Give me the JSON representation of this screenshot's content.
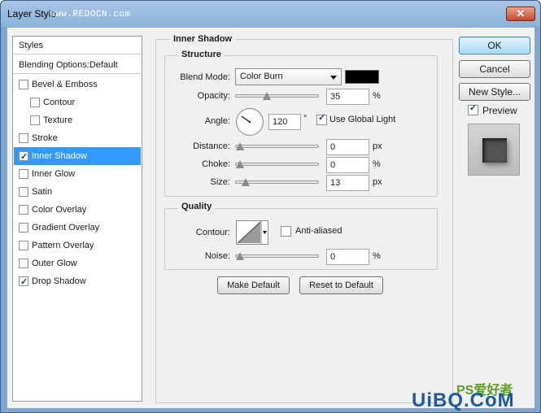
{
  "window": {
    "title": "Layer Style",
    "title_watermark": "www.REDOCN.com",
    "close_label": "✕"
  },
  "styles_list": {
    "header": "Styles",
    "blending_options": "Blending Options:Default",
    "items": [
      {
        "label": "Bevel & Emboss",
        "checked": false,
        "indent": false
      },
      {
        "label": "Contour",
        "checked": false,
        "indent": true
      },
      {
        "label": "Texture",
        "checked": false,
        "indent": true
      },
      {
        "label": "Stroke",
        "checked": false,
        "indent": false
      },
      {
        "label": "Inner Shadow",
        "checked": true,
        "indent": false,
        "selected": true
      },
      {
        "label": "Inner Glow",
        "checked": false,
        "indent": false
      },
      {
        "label": "Satin",
        "checked": false,
        "indent": false
      },
      {
        "label": "Color Overlay",
        "checked": false,
        "indent": false
      },
      {
        "label": "Gradient Overlay",
        "checked": false,
        "indent": false
      },
      {
        "label": "Pattern Overlay",
        "checked": false,
        "indent": false
      },
      {
        "label": "Outer Glow",
        "checked": false,
        "indent": false
      },
      {
        "label": "Drop Shadow",
        "checked": true,
        "indent": false
      }
    ]
  },
  "inner_shadow": {
    "section_title": "Inner Shadow",
    "structure_title": "Structure",
    "blend_mode_label": "Blend Mode:",
    "blend_mode_value": "Color Burn",
    "color": "#000000",
    "opacity_label": "Opacity:",
    "opacity_value": "35",
    "opacity_unit": "%",
    "opacity_level": 0.35,
    "angle_label": "Angle:",
    "angle_value": "120",
    "angle_unit": "°",
    "use_global_light_label": "Use Global Light",
    "use_global_light": true,
    "distance_label": "Distance:",
    "distance_value": "0",
    "distance_unit": "px",
    "choke_label": "Choke:",
    "choke_value": "0",
    "choke_unit": "%",
    "size_label": "Size:",
    "size_value": "13",
    "size_unit": "px",
    "quality_title": "Quality",
    "contour_label": "Contour:",
    "anti_aliased_label": "Anti-aliased",
    "anti_aliased": false,
    "noise_label": "Noise:",
    "noise_value": "0",
    "noise_unit": "%",
    "make_default_label": "Make Default",
    "reset_default_label": "Reset to Default"
  },
  "side_buttons": {
    "ok_label": "OK",
    "cancel_label": "Cancel",
    "new_style_label": "New Style...",
    "preview_label": "Preview",
    "preview_checked": true
  },
  "watermark": {
    "text": "UiBQ.CoM",
    "cn": "PS爱好者"
  }
}
